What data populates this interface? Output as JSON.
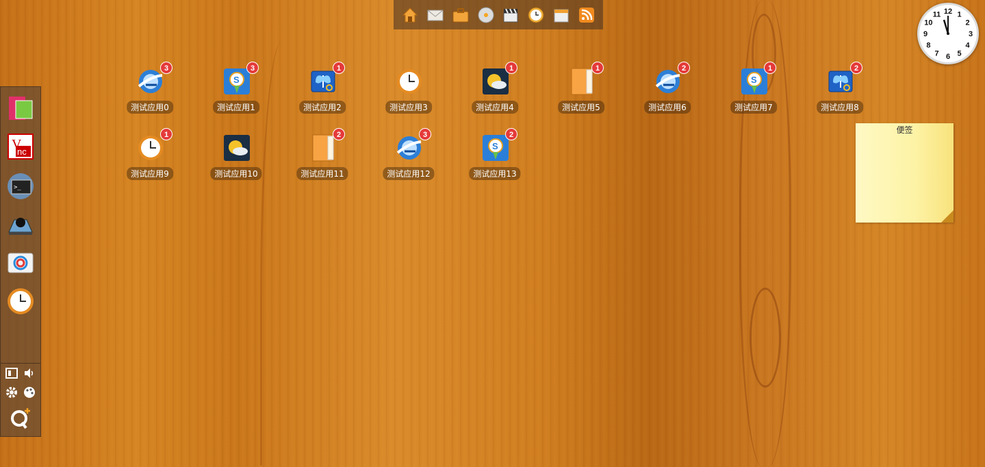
{
  "top_dock": {
    "items": [
      {
        "name": "home",
        "color": "#f3a43a"
      },
      {
        "name": "mail",
        "color": "#e8e6e0"
      },
      {
        "name": "briefcase",
        "color": "#f1a53b"
      },
      {
        "name": "disc",
        "color": "#d8d8d8"
      },
      {
        "name": "clapper",
        "color": "#555555"
      },
      {
        "name": "clock",
        "color": "#f0b03a"
      },
      {
        "name": "calendar",
        "color": "#e6e6e6"
      },
      {
        "name": "rss",
        "color": "#f08a1e"
      }
    ]
  },
  "sidebar": {
    "apps": [
      {
        "name": "photo-app"
      },
      {
        "name": "vnc-app"
      },
      {
        "name": "terminal-app"
      },
      {
        "name": "spy-app"
      },
      {
        "name": "camera-app"
      },
      {
        "name": "clock-app"
      }
    ],
    "tools": [
      "display",
      "volume",
      "settings",
      "theme",
      "qq"
    ]
  },
  "apps": [
    {
      "label": "测试应用0",
      "badge": "3",
      "icon": "browser"
    },
    {
      "label": "测试应用1",
      "badge": "3",
      "icon": "map"
    },
    {
      "label": "测试应用2",
      "badge": "1",
      "icon": "butterfly"
    },
    {
      "label": "测试应用3",
      "badge": "",
      "icon": "clock"
    },
    {
      "label": "测试应用4",
      "badge": "1",
      "icon": "weather"
    },
    {
      "label": "测试应用5",
      "badge": "1",
      "icon": "folder"
    },
    {
      "label": "测试应用6",
      "badge": "2",
      "icon": "browser"
    },
    {
      "label": "测试应用7",
      "badge": "1",
      "icon": "map"
    },
    {
      "label": "测试应用8",
      "badge": "2",
      "icon": "butterfly"
    },
    {
      "label": "测试应用9",
      "badge": "1",
      "icon": "clock"
    },
    {
      "label": "测试应用10",
      "badge": "",
      "icon": "weather"
    },
    {
      "label": "测试应用11",
      "badge": "2",
      "icon": "folder"
    },
    {
      "label": "测试应用12",
      "badge": "3",
      "icon": "browser"
    },
    {
      "label": "测试应用13",
      "badge": "2",
      "icon": "map"
    }
  ],
  "clock": {
    "numbers": [
      "12",
      "1",
      "2",
      "3",
      "4",
      "5",
      "6",
      "7",
      "8",
      "9",
      "10",
      "11"
    ]
  },
  "note": {
    "title": "便签"
  }
}
